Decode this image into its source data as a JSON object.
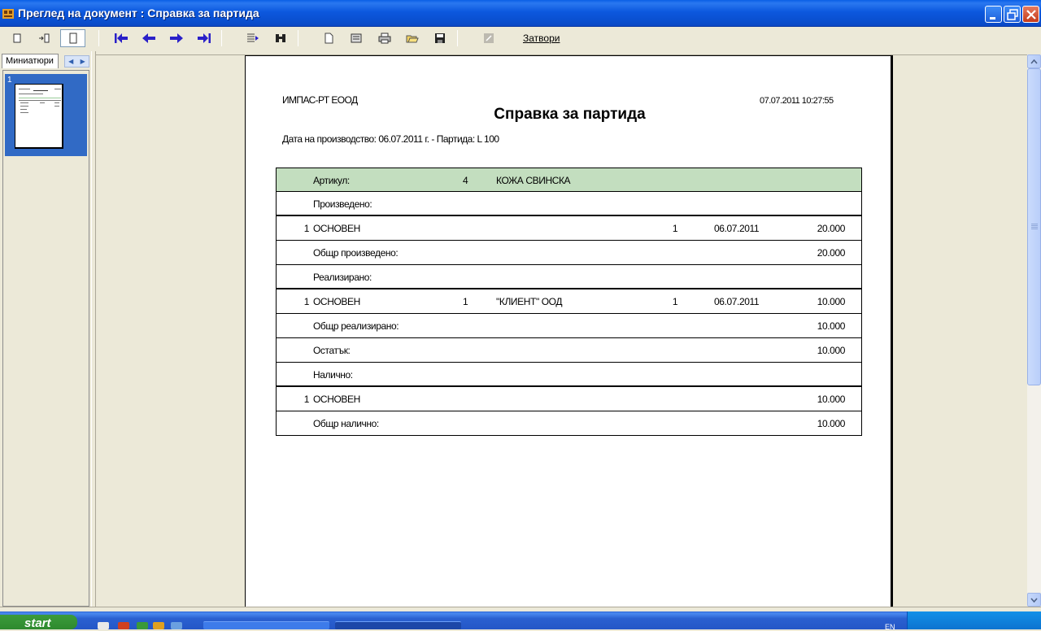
{
  "window": {
    "title": "Преглед на документ : Справка за партида"
  },
  "toolbar": {
    "close_label": "Затвори"
  },
  "sidebar": {
    "tab_label": "Миниатюри",
    "thumb_number": "1"
  },
  "report": {
    "company": "ИМПАС-РТ ЕООД",
    "timestamp": "07.07.2011 10:27:55",
    "title": "Справка за партида",
    "subtitle": "Дата на производство: 06.07.2011 г. - Партида: L 100",
    "rows": [
      {
        "idx": "",
        "name": "Артикул:",
        "num": "4",
        "client": "КОЖА СВИНСКА",
        "qty": "",
        "date": "",
        "val": ""
      },
      {
        "idx": "",
        "name": "Произведено:",
        "num": "",
        "client": "",
        "qty": "",
        "date": "",
        "val": ""
      },
      {
        "idx": "1",
        "name": "ОСНОВЕН",
        "num": "",
        "client": "",
        "qty": "1",
        "date": "06.07.2011",
        "val": "20.000"
      },
      {
        "idx": "",
        "name": "Общр произведено:",
        "num": "",
        "client": "",
        "qty": "",
        "date": "",
        "val": "20.000"
      },
      {
        "idx": "",
        "name": "Реализирано:",
        "num": "",
        "client": "",
        "qty": "",
        "date": "",
        "val": ""
      },
      {
        "idx": "1",
        "name": "ОСНОВЕН",
        "num": "1",
        "client": "\"КЛИЕНТ\" ООД",
        "qty": "1",
        "date": "06.07.2011",
        "val": "10.000"
      },
      {
        "idx": "",
        "name": "Общр реализирано:",
        "num": "",
        "client": "",
        "qty": "",
        "date": "",
        "val": "10.000"
      },
      {
        "idx": "",
        "name": "Остатък:",
        "num": "",
        "client": "",
        "qty": "",
        "date": "",
        "val": "10.000"
      },
      {
        "idx": "",
        "name": "Налично:",
        "num": "",
        "client": "",
        "qty": "",
        "date": "",
        "val": ""
      },
      {
        "idx": "1",
        "name": "ОСНОВЕН",
        "num": "",
        "client": "",
        "qty": "",
        "date": "",
        "val": "10.000"
      },
      {
        "idx": "",
        "name": "Общр налично:",
        "num": "",
        "client": "",
        "qty": "",
        "date": "",
        "val": "10.000"
      }
    ]
  },
  "taskbar": {
    "start_label": "start",
    "language": "EN"
  },
  "colors": {
    "header_row": "#C3DEBF",
    "nav_arrows": "#2A20C8",
    "selection": "#316AC5"
  },
  "icons": [
    "app-icon",
    "minimize-icon",
    "restore-icon",
    "close-icon",
    "page-width-icon",
    "two-pages-icon",
    "whole-page-icon",
    "first-page-icon",
    "prev-page-icon",
    "next-page-icon",
    "last-page-icon",
    "goto-page-icon",
    "find-icon",
    "page-setup-icon",
    "export-icon",
    "print-icon",
    "open-icon",
    "save-icon",
    "edit-icon"
  ]
}
